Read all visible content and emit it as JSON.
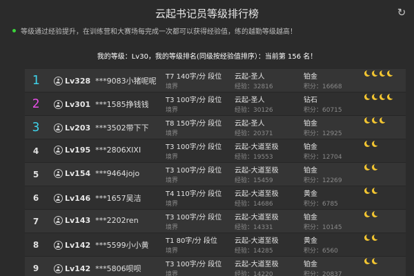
{
  "header": {
    "title": "云起书记员等级排行榜"
  },
  "notice": "等级通过经验提升，在训练营和大赛场每完成一次都可以获得经验值，练的越勤等级越高！",
  "my_rank": "我的等级：Lv30，我的等级排名(同级按经验值排序）：当前第 156 名！",
  "rows": [
    {
      "rank": "1",
      "level": "Lv328",
      "name": "***9083小猪呢呢",
      "speed": "T7 140字/分 段位",
      "realm_label": "境界",
      "rank_name": "云起-圣人",
      "exp": "经验：32816",
      "tier": "铂金",
      "points": "积分：16668",
      "moons": 4
    },
    {
      "rank": "2",
      "level": "Lv301",
      "name": "***1585挣钱钱",
      "speed": "T3 100字/分 段位",
      "realm_label": "境界",
      "rank_name": "云起-圣人",
      "exp": "经验：30126",
      "tier": "钻石",
      "points": "积分：60715",
      "moons": 4
    },
    {
      "rank": "3",
      "level": "Lv203",
      "name": "***3502带下下",
      "speed": "T8 150字/分 段位",
      "realm_label": "境界",
      "rank_name": "云起-圣人",
      "exp": "经验：20371",
      "tier": "铂金",
      "points": "积分：12925",
      "moons": 3
    },
    {
      "rank": "4",
      "level": "Lv195",
      "name": "***2806XIXI",
      "speed": "T3 100字/分 段位",
      "realm_label": "境界",
      "rank_name": "云起-大道至极",
      "exp": "经验：19553",
      "tier": "铂金",
      "points": "积分：12704",
      "moons": 2
    },
    {
      "rank": "5",
      "level": "Lv154",
      "name": "***9464jojo",
      "speed": "T3 100字/分 段位",
      "realm_label": "境界",
      "rank_name": "云起-大道至极",
      "exp": "经验：15459",
      "tier": "铂金",
      "points": "积分：12269",
      "moons": 2
    },
    {
      "rank": "6",
      "level": "Lv146",
      "name": "***1657吴洁",
      "speed": "T4 110字/分 段位",
      "realm_label": "境界",
      "rank_name": "云起-大道至极",
      "exp": "经验：14686",
      "tier": "黄金",
      "points": "积分：6785",
      "moons": 2
    },
    {
      "rank": "7",
      "level": "Lv143",
      "name": "***2202ren",
      "speed": "T3 100字/分 段位",
      "realm_label": "境界",
      "rank_name": "云起-大道至极",
      "exp": "经验：14331",
      "tier": "铂金",
      "points": "积分：10145",
      "moons": 2
    },
    {
      "rank": "8",
      "level": "Lv142",
      "name": "***5599小小黄",
      "speed": "T1 80字/分 段位",
      "realm_label": "境界",
      "rank_name": "云起-大道至极",
      "exp": "经验：14285",
      "tier": "黄金",
      "points": "积分：6560",
      "moons": 2
    },
    {
      "rank": "9",
      "level": "Lv142",
      "name": "***5806呗呗",
      "speed": "T3 100字/分 段位",
      "realm_label": "境界",
      "rank_name": "云起-大道至极",
      "exp": "经验：14220",
      "tier": "铂金",
      "points": "积分：20837",
      "moons": 2
    }
  ],
  "colors": {
    "rank1": "#3fd1e8",
    "rank2": "#e84fe8",
    "rank3": "#3fd1e8",
    "moon": "#f2c531",
    "notice_dot": "#3bd43b",
    "background": "#2b2b2b"
  },
  "icons": {
    "refresh": "refresh-icon",
    "user": "user-icon",
    "moon": "moon-icon"
  }
}
